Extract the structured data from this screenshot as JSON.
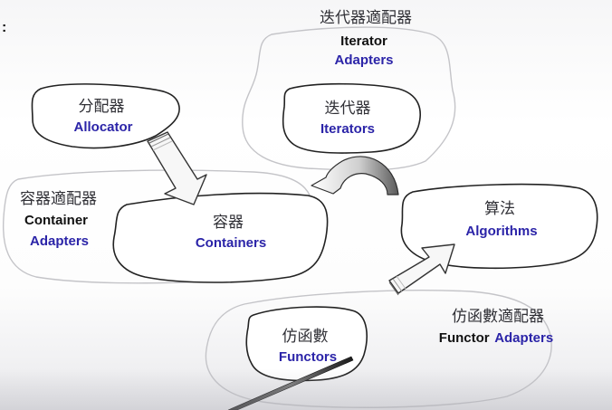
{
  "corner_mark": ":",
  "nodes": {
    "allocator": {
      "zh": "分配器",
      "en": "Allocator"
    },
    "iterator_adapters": {
      "zh": "迭代器適配器",
      "en_line1": "Iterator",
      "en_line2": "Adapters"
    },
    "iterators": {
      "zh": "迭代器",
      "en": "Iterators"
    },
    "container_adapters": {
      "zh": "容器適配器",
      "en_line1": "Container",
      "en_line2": "Adapters"
    },
    "containers": {
      "zh": "容器",
      "en": "Containers"
    },
    "algorithms": {
      "zh": "算法",
      "en": "Algorithms"
    },
    "functor_adapters": {
      "zh": "仿函數適配器",
      "en_black": "Functor",
      "en_blue": "Adapters"
    },
    "functors": {
      "zh": "仿函數",
      "en": "Functors"
    }
  },
  "colors": {
    "label_blue": "#2b24a8",
    "label_black": "#111111",
    "outline_dark": "#222222",
    "outline_light": "#c4c4c8",
    "arrow_fill": "#f7f7f7"
  }
}
